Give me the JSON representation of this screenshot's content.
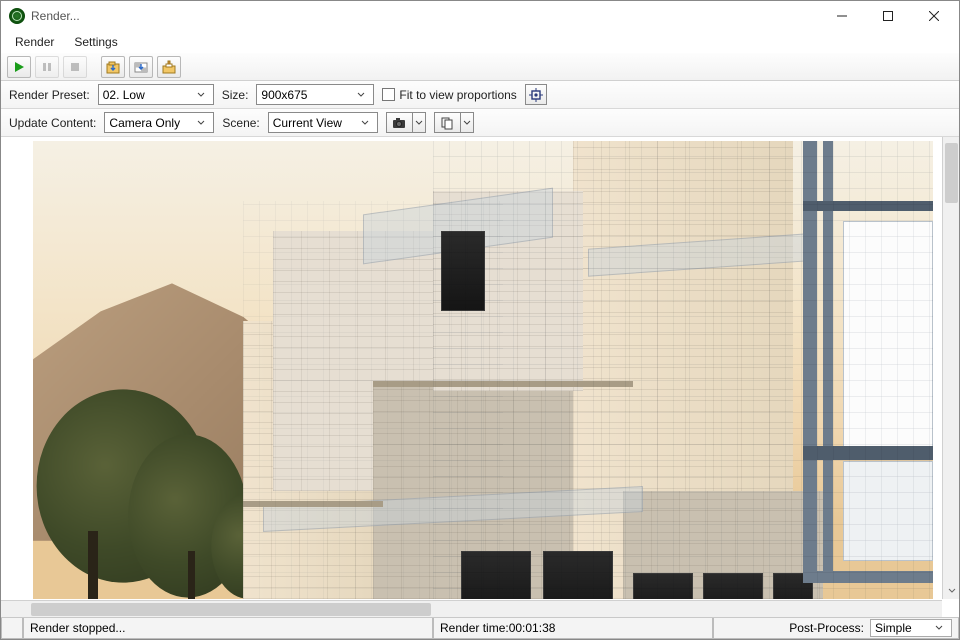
{
  "window": {
    "title": "Render..."
  },
  "menu": {
    "render": "Render",
    "settings": "Settings"
  },
  "toolbar": {
    "play": "play",
    "pause": "pause",
    "stop": "stop",
    "save": "save",
    "save_alpha": "save-alpha",
    "print": "print"
  },
  "options_row1": {
    "render_preset_label": "Render Preset:",
    "render_preset_value": "02. Low",
    "size_label": "Size:",
    "size_value": "900x675",
    "fit_label": "Fit to view proportions"
  },
  "options_row2": {
    "update_content_label": "Update Content:",
    "update_content_value": "Camera Only",
    "scene_label": "Scene:",
    "scene_value": "Current View"
  },
  "viewport": {
    "image_description": "architectural render of modern concrete building at sunset with wireframe overlay"
  },
  "status": {
    "message": "Render stopped...",
    "render_time_label": "Render time: ",
    "render_time_value": "00:01:38",
    "post_process_label": "Post-Process:",
    "post_process_value": "Simple"
  }
}
